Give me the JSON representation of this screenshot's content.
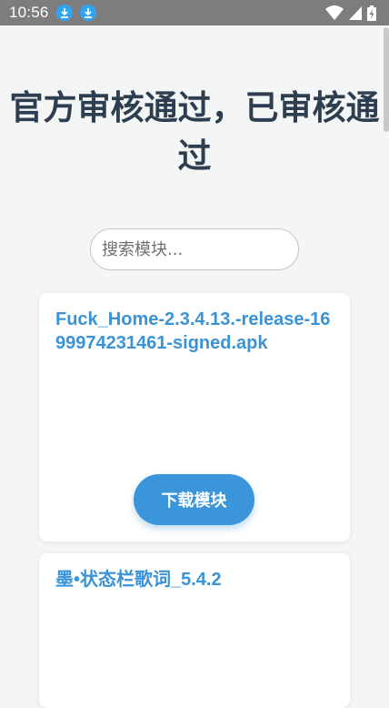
{
  "status_bar": {
    "time": "10:56",
    "icons": [
      "download-icon",
      "download-icon",
      "wifi-icon",
      "signal-icon",
      "battery-charging-icon"
    ]
  },
  "page": {
    "title": "官方审核通过，已审核通过"
  },
  "search": {
    "placeholder": "搜索模块..."
  },
  "modules": [
    {
      "name": "Fuck_Home-2.3.4.13.-release-1699974231461-signed.apk",
      "button_label": "下载模块"
    },
    {
      "name": "墨•状态栏歌词_5.4.2"
    }
  ],
  "colors": {
    "status_bar": "#7d7d7d",
    "title": "#2c3e50",
    "accent": "#3a95da",
    "background": "#f4f5f5"
  }
}
